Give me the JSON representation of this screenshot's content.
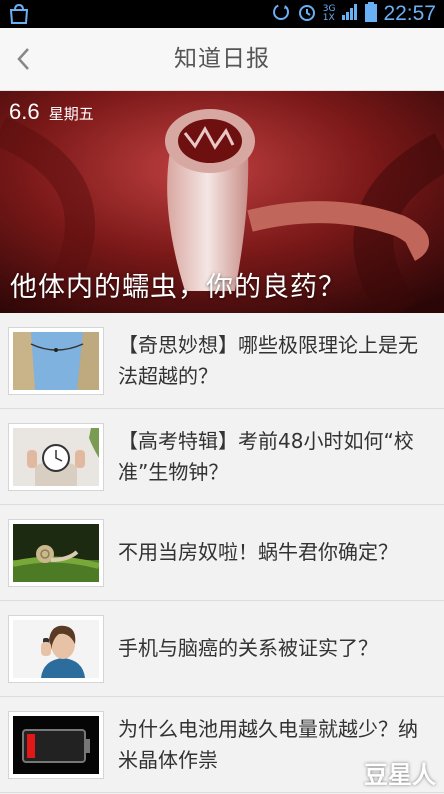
{
  "status_bar": {
    "time": "22:57",
    "network_top": "3G",
    "network_bottom": "1X",
    "icons": [
      "store-icon",
      "sync-icon",
      "alarm-icon",
      "signal-icon",
      "battery-icon"
    ]
  },
  "header": {
    "title": "知道日报",
    "back_icon": "chevron-left-icon"
  },
  "hero": {
    "date": "6.6",
    "weekday": "星期五",
    "title": "他体内的蠕虫，你的良药？"
  },
  "articles": [
    {
      "title": "【奇思妙想】哪些极限理论上是无法超越的？",
      "thumb": "rope-cliffs-image"
    },
    {
      "title": "【高考特辑】考前48小时如何“校准”生物钟？",
      "thumb": "clock-image"
    },
    {
      "title": "不用当房奴啦！蜗牛君你确定？",
      "thumb": "snail-image"
    },
    {
      "title": "手机与脑癌的关系被证实了？",
      "thumb": "woman-phone-image"
    },
    {
      "title": "为什么电池用越久电量就越少？纳米晶体作祟",
      "thumb": "battery-image"
    }
  ],
  "watermark": "豆星人",
  "colors": {
    "status_blue": "#6ab0f5",
    "hero_red": "#8a1a1a"
  }
}
